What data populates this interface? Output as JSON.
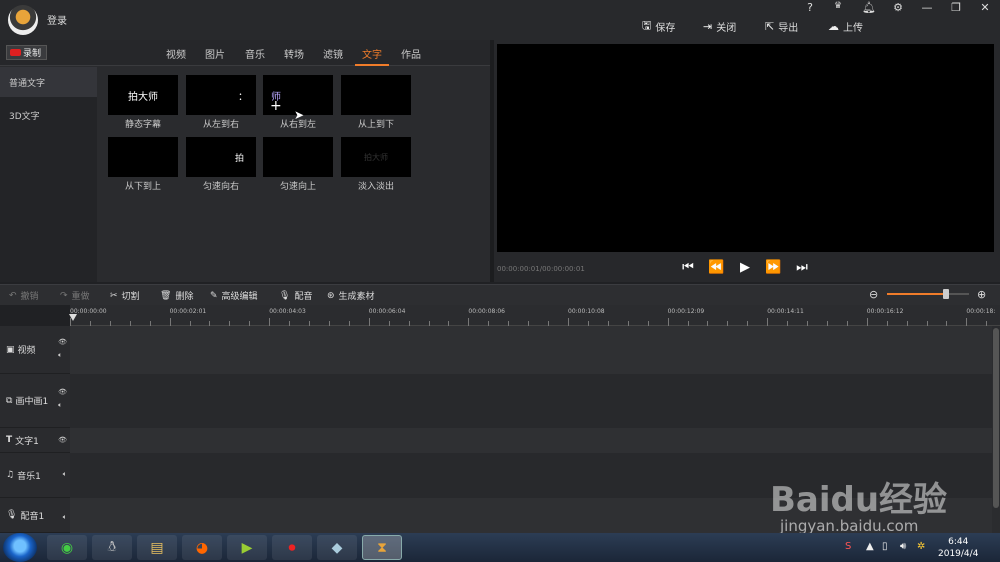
{
  "titlebar": {
    "login": "登录",
    "help": "?",
    "vip": "VIP",
    "save": "保存",
    "close": "关闭",
    "export": "导出",
    "upload": "上传"
  },
  "record_button": "录制",
  "tabs": [
    "视频",
    "图片",
    "音乐",
    "转场",
    "滤镜",
    "文字",
    "作品"
  ],
  "active_tab": "文字",
  "sidebar": [
    {
      "label": "普通文字",
      "selected": true
    },
    {
      "label": "3D文字",
      "selected": false
    }
  ],
  "thumbnails": [
    {
      "preview": "拍大师",
      "label": "静态字幕"
    },
    {
      "preview": "：",
      "label": "从左到右"
    },
    {
      "preview": "师",
      "label": "从右到左"
    },
    {
      "preview": "",
      "label": "从上到下"
    },
    {
      "preview": "",
      "label": "从下到上"
    },
    {
      "preview": "拍",
      "label": "匀速向右"
    },
    {
      "preview": "",
      "label": "匀速向上"
    },
    {
      "preview": "拍大师",
      "label": "淡入淡出"
    }
  ],
  "preview": {
    "timecode": "00:00:00:01/00:00:00:01"
  },
  "toolbar": {
    "undo": "撤销",
    "redo": "重做",
    "cut": "切割",
    "delete": "删除",
    "advanced_edit": "高级编辑",
    "dubbing": "配音",
    "generate": "生成素材",
    "zoom_level": 0.72
  },
  "ruler": [
    "00:00:00:00",
    "00:00:02:01",
    "00:00:04:03",
    "00:00:06:04",
    "00:00:08:06",
    "00:00:10:08",
    "00:00:12:09",
    "00:00:14:11",
    "00:00:16:12",
    "00:00:18:"
  ],
  "tracks": [
    {
      "label": "视频",
      "icon": "play-square-icon"
    },
    {
      "label": "画中画1",
      "icon": "pip-icon"
    },
    {
      "label": "文字1",
      "icon": "text-icon"
    },
    {
      "label": "音乐1",
      "icon": "music-note-icon"
    },
    {
      "label": "配音1",
      "icon": "microphone-icon"
    }
  ],
  "taskbar": {
    "time": "6:44",
    "date": "2019/4/4"
  },
  "watermark": {
    "text": "Baidu经验",
    "url": "jingyan.baidu.com"
  },
  "colors": {
    "accent": "#f07c2a",
    "record": "#e02020"
  }
}
